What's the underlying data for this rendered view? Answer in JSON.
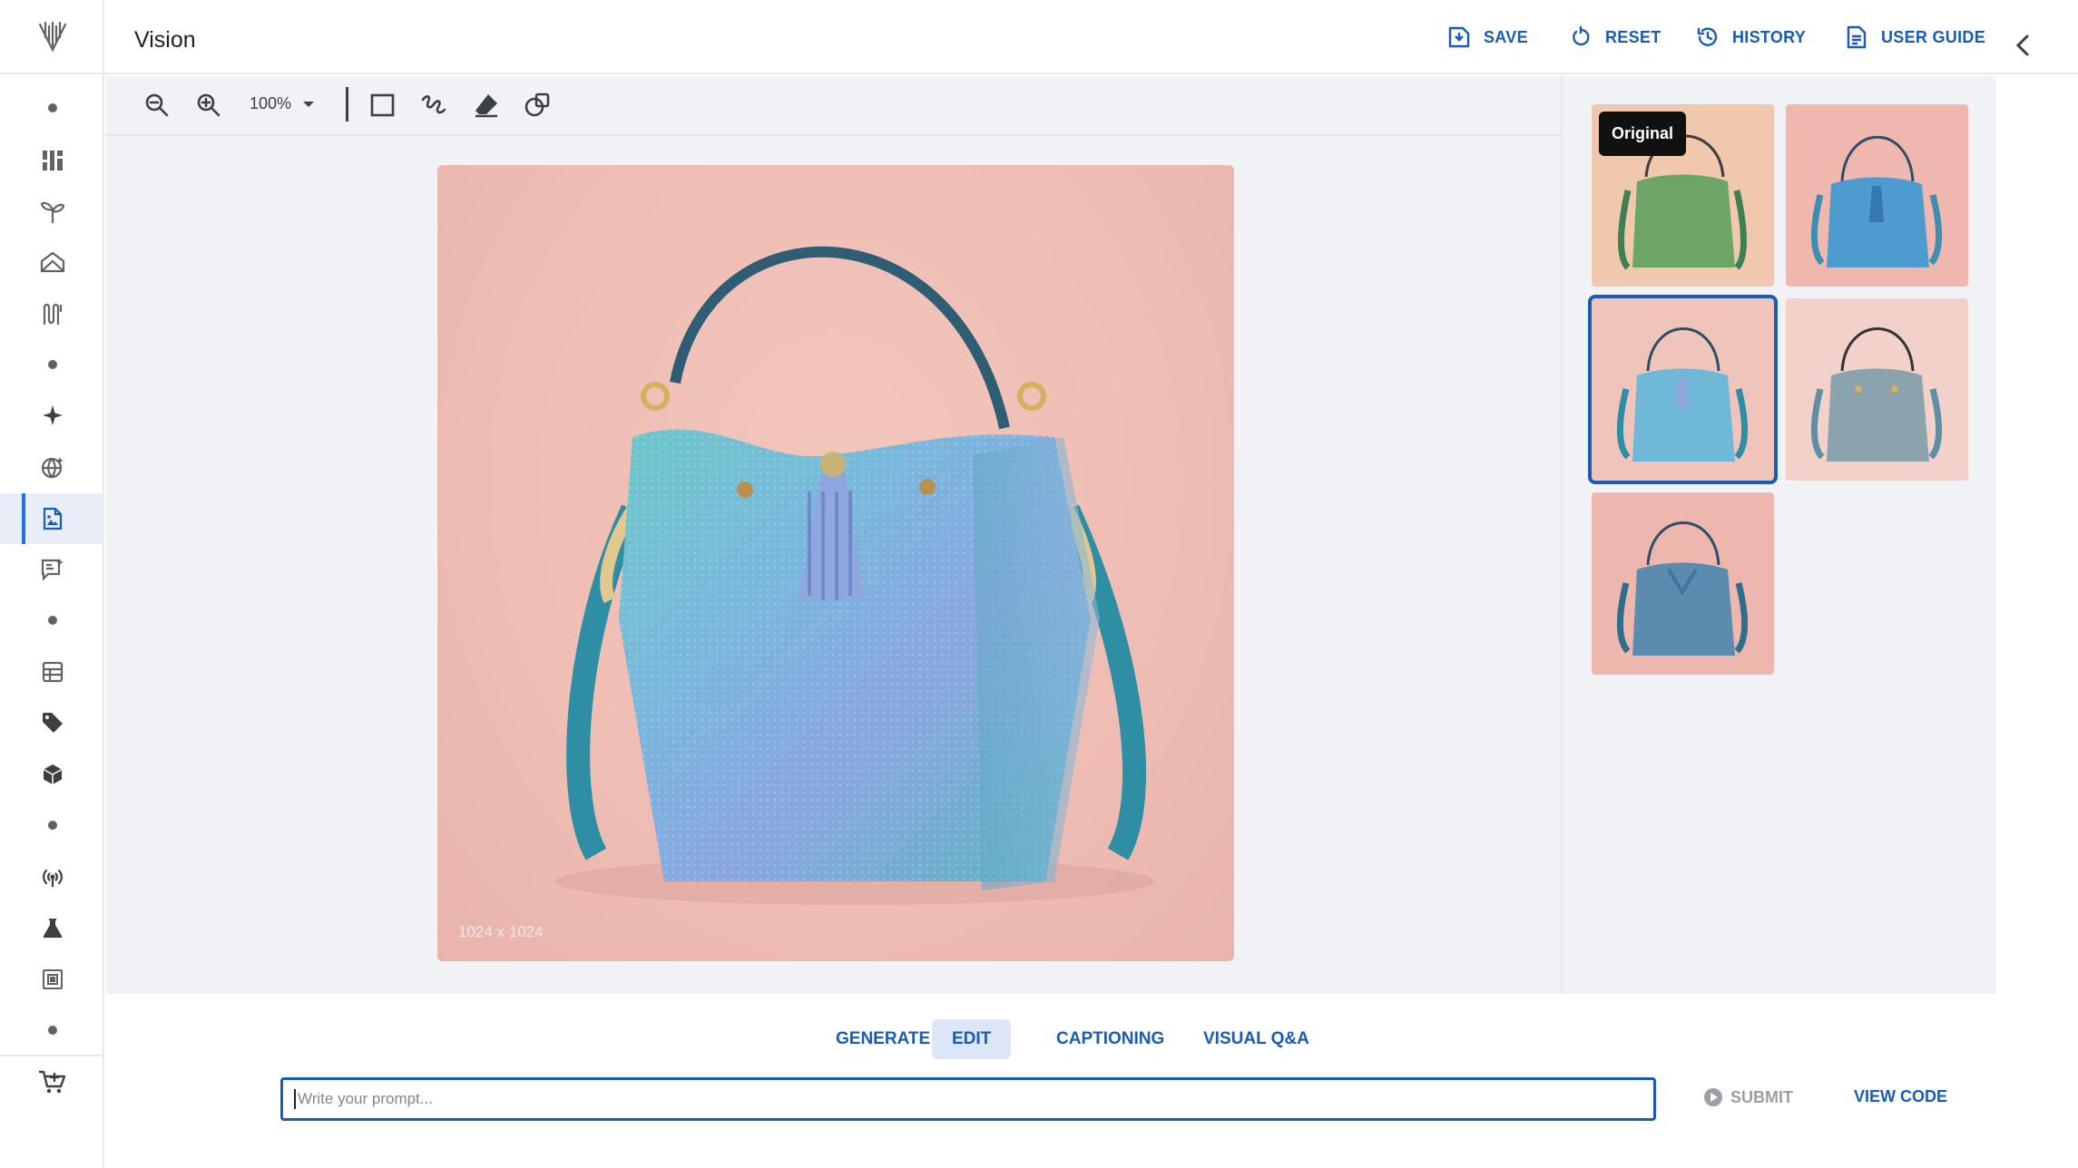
{
  "app": {
    "title": "Vision"
  },
  "header": {
    "save_label": "SAVE",
    "reset_label": "RESET",
    "history_label": "HISTORY",
    "user_guide_label": "USER GUIDE"
  },
  "toolbar": {
    "zoom_value": "100%"
  },
  "canvas": {
    "image_size": "1024 x 1024"
  },
  "thumbnails": {
    "tooltip": "Original",
    "items": [
      {
        "variant": "green",
        "selected": false
      },
      {
        "variant": "blue-on-pink",
        "selected": false
      },
      {
        "variant": "iridescent-blue",
        "selected": true
      },
      {
        "variant": "silver",
        "selected": false
      },
      {
        "variant": "teal-iridescent",
        "selected": false
      }
    ]
  },
  "tabs": [
    {
      "label": "GENERATE",
      "active": false
    },
    {
      "label": "EDIT",
      "active": true
    },
    {
      "label": "CAPTIONING",
      "active": false
    },
    {
      "label": "VISUAL Q&A",
      "active": false
    }
  ],
  "prompt": {
    "placeholder": "Write your prompt..."
  },
  "actions": {
    "submit_label": "SUBMIT",
    "view_code_label": "VIEW CODE"
  },
  "colors": {
    "accent": "#1a5bb8",
    "background": "#f0f2f5",
    "active_tab_bg": "#dce6f8"
  },
  "rail_icons": [
    "dot",
    "dashboard-icon",
    "sprout-icon",
    "model-garden-icon",
    "pipeline-icon",
    "dot",
    "sparkle-icon",
    "globe-icon",
    "image-doc-icon",
    "speech-icon",
    "dot",
    "table-icon",
    "tag-icon",
    "cube-icon",
    "dot",
    "broadcast-icon",
    "flask-icon",
    "chip-icon",
    "dot",
    "cart-icon"
  ]
}
